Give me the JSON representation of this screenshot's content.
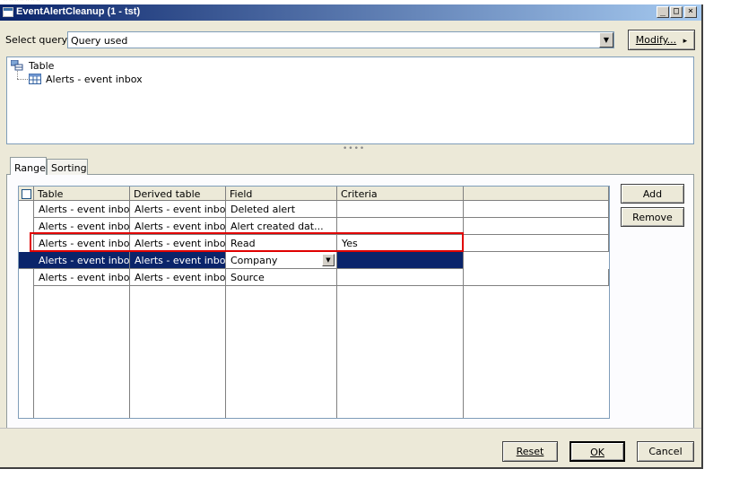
{
  "top_cut_text": "«««««««",
  "window": {
    "title": "EventAlertCleanup (1 - tst)",
    "minimize": "_",
    "restore": "□",
    "close": "×"
  },
  "query": {
    "label": "Select query:",
    "value": "Query used",
    "modify_label": "Modify...",
    "modify_arrow": "▸"
  },
  "tree": {
    "root": "Table",
    "child": "Alerts - event inbox"
  },
  "splitter": "••••",
  "tabs": [
    {
      "label": "Range"
    },
    {
      "label": "Sorting"
    }
  ],
  "grid": {
    "headers": [
      "Table",
      "Derived table",
      "Field",
      "Criteria",
      ""
    ],
    "rows": [
      {
        "table": "Alerts - event inbox",
        "derived": "Alerts - event inbox",
        "field": "Deleted alert",
        "criteria": ""
      },
      {
        "table": "Alerts - event inbox",
        "derived": "Alerts - event inbox",
        "field": "Alert created dat...",
        "criteria": ""
      },
      {
        "table": "Alerts - event inbox",
        "derived": "Alerts - event inbox",
        "field": "Read",
        "criteria": "Yes"
      },
      {
        "table": "Alerts - event inbox",
        "derived": "Alerts - event inbox",
        "field": "Company",
        "criteria": ""
      },
      {
        "table": "Alerts - event inbox",
        "derived": "Alerts - event inbox",
        "field": "Source",
        "criteria": ""
      }
    ],
    "selected_row": 3,
    "highlighted_row": 2
  },
  "side_buttons": {
    "add": "Add",
    "remove": "Remove"
  },
  "footer": {
    "reset": "Reset",
    "ok": "OK",
    "cancel": "Cancel"
  },
  "colors": {
    "title_gradient_start": "#0a246a",
    "title_gradient_end": "#a6caf0",
    "selection": "#0a246a",
    "highlight_box": "#e00000",
    "dialog_bg": "#ece9d8"
  }
}
